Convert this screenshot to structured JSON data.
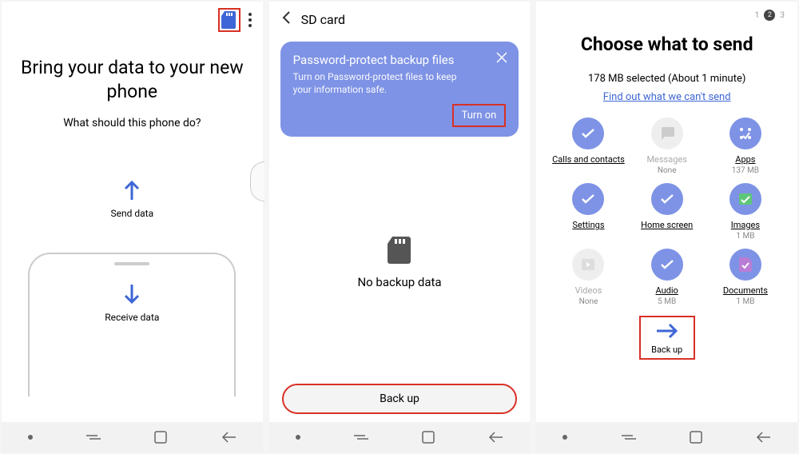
{
  "screen1": {
    "title": "Bring your data to your new phone",
    "subtitle": "What should this phone do?",
    "send": "Send data",
    "receive": "Receive data"
  },
  "screen2": {
    "header": "SD card",
    "tooltip_title": "Password-protect backup files",
    "tooltip_desc": "Turn on Password-protect files to keep your information safe.",
    "turn_on": "Turn on",
    "no_backup": "No backup data",
    "backup_btn": "Back up"
  },
  "screen3": {
    "steps": [
      "1",
      "2",
      "3"
    ],
    "title": "Choose what to send",
    "selected": "178 MB  selected (About 1 minute)",
    "link": "Find out what we can't send",
    "items": [
      {
        "label": "Calls and contacts",
        "sub": "",
        "enabled": true,
        "icon": "check"
      },
      {
        "label": "Messages",
        "sub": "None",
        "enabled": false,
        "icon": "message"
      },
      {
        "label": "Apps",
        "sub": "137 MB",
        "enabled": true,
        "icon": "apps"
      },
      {
        "label": "Settings",
        "sub": "",
        "enabled": true,
        "icon": "check"
      },
      {
        "label": "Home screen",
        "sub": "",
        "enabled": true,
        "icon": "check"
      },
      {
        "label": "Images",
        "sub": "1 MB",
        "enabled": true,
        "icon": "images"
      },
      {
        "label": "Videos",
        "sub": "None",
        "enabled": false,
        "icon": "video"
      },
      {
        "label": "Audio",
        "sub": "5 MB",
        "enabled": true,
        "icon": "check"
      },
      {
        "label": "Documents",
        "sub": "1 MB",
        "enabled": true,
        "icon": "doc"
      }
    ],
    "backup_btn": "Back up"
  }
}
